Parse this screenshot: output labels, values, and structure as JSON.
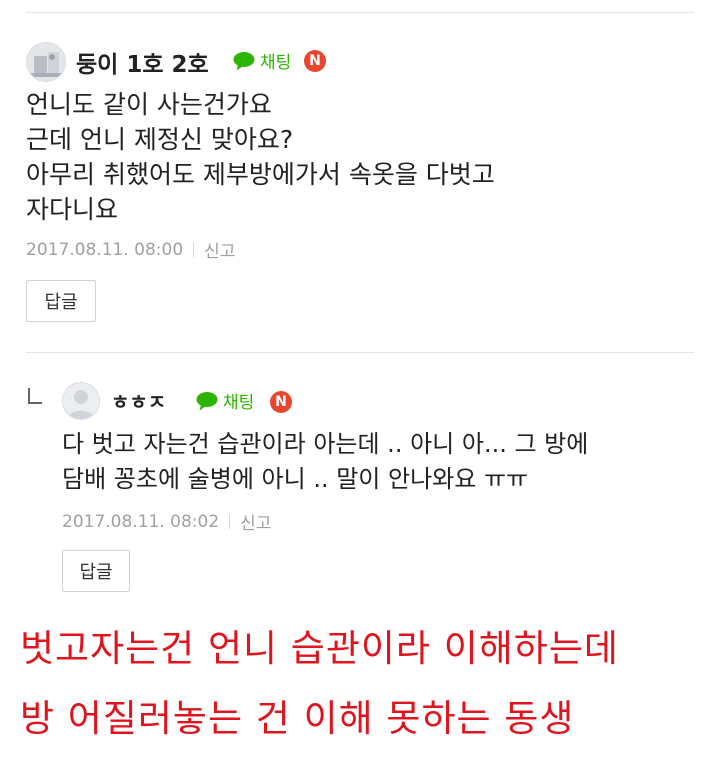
{
  "comments": [
    {
      "username": "둥이 1호 2호",
      "chat_label": "채팅",
      "n_badge": "N",
      "lines": [
        "언니도 같이 사는건가요",
        "근데 언니 제정신 맞아요?",
        "아무리 취했어도 제부방에가서 속옷을 다벗고",
        "자다니요"
      ],
      "timestamp": "2017.08.11. 08:00",
      "report_label": "신고",
      "reply_label": "답글"
    },
    {
      "username": "ㅎㅎㅈ",
      "chat_label": "채팅",
      "n_badge": "N",
      "lines": [
        "다 벗고 자는건 습관이라 아는데 .. 아니 아... 그 방에",
        "담배 꽁초에 술병에 아니 .. 말이 안나와요 ㅠㅠ"
      ],
      "timestamp": "2017.08.11. 08:02",
      "report_label": "신고",
      "reply_label": "답글"
    }
  ],
  "caption": {
    "lines": [
      "벗고자는건 언니 습관이라 이해하는데",
      "방 어질러놓는 건 이해 못하는 동생"
    ],
    "color": "#e0141e"
  },
  "colors": {
    "chat_green": "#2db400",
    "n_red": "#e8472e",
    "meta_gray": "#a0a0a0"
  }
}
